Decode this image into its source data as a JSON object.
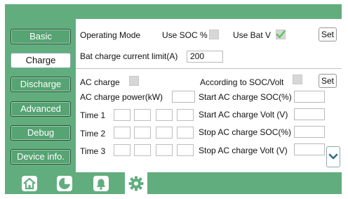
{
  "sidebar": {
    "items": [
      {
        "label": "Basic"
      },
      {
        "label": "Charge"
      },
      {
        "label": "Discharge"
      },
      {
        "label": "Advanced"
      },
      {
        "label": "Debug"
      },
      {
        "label": "Device info."
      }
    ],
    "active_index": 1
  },
  "operating_mode": {
    "label": "Operating Mode",
    "use_soc_label": "Use SOC %",
    "use_soc_checked": false,
    "use_bat_v_label": "Use Bat V",
    "use_bat_v_checked": true,
    "set_label": "Set"
  },
  "bat_charge_limit": {
    "label": "Bat charge current limit(A)",
    "value": "200"
  },
  "ac_charge": {
    "label": "AC charge",
    "checked": false,
    "according_label": "According to SOC/Volt",
    "according_checked": false,
    "set_label": "Set",
    "power_label": "AC charge power(kW)",
    "power_value": "",
    "start_soc_label": "Start AC charge SOC(%)",
    "start_soc_value": "",
    "start_volt_label": "Start AC charge Volt (V)",
    "start_volt_value": "",
    "stop_soc_label": "Stop AC charge SOC(%)",
    "stop_soc_value": "",
    "stop_volt_label": "Stop AC charge Volt (V)",
    "stop_volt_value": "",
    "times": [
      {
        "label": "Time  1"
      },
      {
        "label": "Time  2"
      },
      {
        "label": "Time  3"
      }
    ]
  },
  "bottom_nav": [
    {
      "icon": "home-icon"
    },
    {
      "icon": "pie-chart-icon"
    },
    {
      "icon": "bell-icon"
    },
    {
      "icon": "gear-icon"
    }
  ],
  "colors": {
    "accent_green": "#62ad7e",
    "check_green": "#5cc25a"
  }
}
